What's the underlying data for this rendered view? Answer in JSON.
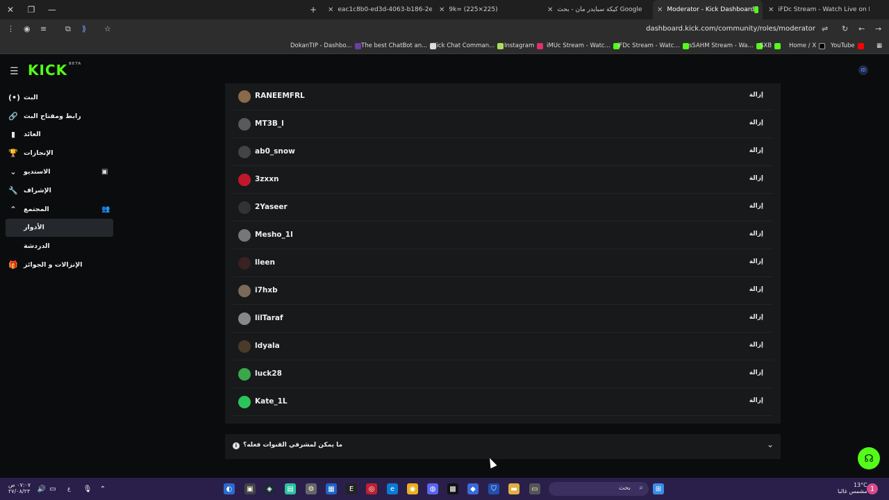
{
  "browser": {
    "tabs": [
      {
        "title": "eac1c8b0-ed3d-4063-b186-2e...",
        "active": false
      },
      {
        "title": "9k= (225×225)",
        "active": false
      },
      {
        "title": "كيكة سبايدر مان - بحث Google",
        "active": false
      },
      {
        "title": "Moderator - Kick Dashboard",
        "active": true
      },
      {
        "title": "iFDc Stream - Watch Live on Ki...",
        "active": false
      }
    ],
    "url": "dashboard.kick.com/community/roles/moderator",
    "bookmarks": [
      "DokanTIP - Dashbo...",
      "The best ChatBot an...",
      "Kick Chat Comman...",
      "Instagram",
      "iMUc Stream - Watc...",
      "iFDc Stream - Watc...",
      "sSAHM Stream - Wa...",
      "SXB",
      "Home / X",
      "YouTube"
    ]
  },
  "app": {
    "logo": "KICK",
    "logo_badge": "BETA",
    "sidebar": [
      {
        "label": "البث",
        "icon": "broadcast-icon",
        "symbol": "(•)"
      },
      {
        "label": "رابط ومفتاح البث",
        "icon": "link-icon",
        "symbol": "🔗"
      },
      {
        "label": "العائد",
        "icon": "chart-icon",
        "symbol": "▮"
      },
      {
        "label": "الإنجازات",
        "icon": "trophy-icon",
        "symbol": "🏆"
      },
      {
        "label": "الاستديو",
        "icon": "chevron-down-icon",
        "symbol": "⌄",
        "right": "▣"
      },
      {
        "label": "الإشراف",
        "icon": "wrench-icon",
        "symbol": "🔧"
      },
      {
        "label": "المجتمع",
        "icon": "chevron-up-icon",
        "symbol": "⌃",
        "right": "👥"
      },
      {
        "label": "الأدوار",
        "icon": "",
        "symbol": "",
        "active": true
      },
      {
        "label": "الدردشة",
        "icon": "",
        "symbol": ""
      },
      {
        "label": "الإنزالات و الجوائز",
        "icon": "gift-icon",
        "symbol": "🎁"
      }
    ],
    "moderators": [
      {
        "name": "RANEEMFRL",
        "remove_label": "إزالة",
        "avatar_color": "#8a6a4a"
      },
      {
        "name": "MT3B_l",
        "remove_label": "إزالة",
        "avatar_color": "#5a5a5a"
      },
      {
        "name": "ab0_snow",
        "remove_label": "إزالة",
        "avatar_color": "#444"
      },
      {
        "name": "3zxxn",
        "remove_label": "إزالة",
        "avatar_color": "#c0182a"
      },
      {
        "name": "2Yaseer",
        "remove_label": "إزالة",
        "avatar_color": "#333"
      },
      {
        "name": "Mesho_1l",
        "remove_label": "إزالة",
        "avatar_color": "#777"
      },
      {
        "name": "lleen",
        "remove_label": "إزالة",
        "avatar_color": "#3a2222"
      },
      {
        "name": "i7hxb",
        "remove_label": "إزالة",
        "avatar_color": "#7a6a5a"
      },
      {
        "name": "lilTaraf",
        "remove_label": "إزالة",
        "avatar_color": "#888"
      },
      {
        "name": "ldyala",
        "remove_label": "إزالة",
        "avatar_color": "#4a3a2a"
      },
      {
        "name": "luck28",
        "remove_label": "إزالة",
        "avatar_color": "#3aa84a"
      },
      {
        "name": "Kate_1L",
        "remove_label": "إزالة",
        "avatar_color": "#2ac45a"
      }
    ],
    "faq_question": "ما يمكن لمشرفي القنوات فعله؟"
  },
  "taskbar": {
    "search_placeholder": "بحث",
    "time": "٠٧:٠٧ ص",
    "date": "٢٧/٠٨/٢٣",
    "weather_temp": "13°C",
    "weather_desc": "مشمس غالبا",
    "lang": "ع"
  },
  "colors": {
    "accent": "#53fc18",
    "panel": "#18191b",
    "bg": "#0b0c0d"
  }
}
